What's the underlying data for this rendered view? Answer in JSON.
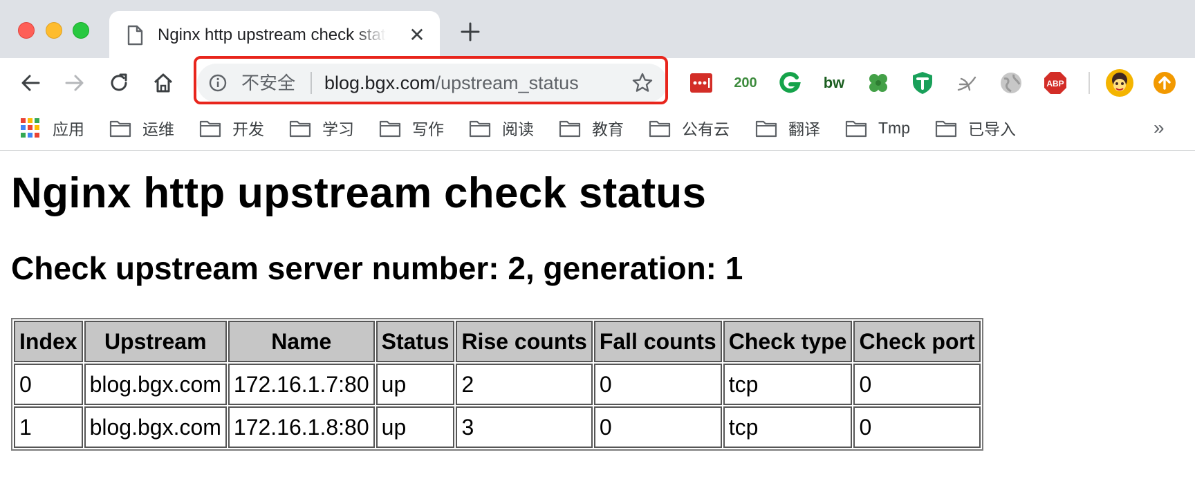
{
  "browser": {
    "tab": {
      "title": "Nginx http upstream check status"
    },
    "address_bar": {
      "security_label": "不安全",
      "url_host": "blog.bgx.com",
      "url_path": "/upstream_status"
    },
    "extensions": [
      {
        "name": "lastpass-icon",
        "text": "•••|",
        "color": "#d32d27"
      },
      {
        "name": "status-200-icon",
        "text": "200",
        "color": "#3d8b3d"
      },
      {
        "name": "grammarly-icon",
        "text": "G",
        "color": "#15c39a"
      },
      {
        "name": "bw-icon",
        "text": "bw",
        "color": "#1b5e20"
      },
      {
        "name": "clover-icon",
        "text": "",
        "color": "#43a047"
      },
      {
        "name": "shield-t-icon",
        "text": "T",
        "color": "#19a05a"
      },
      {
        "name": "calligraphy-icon",
        "text": "",
        "color": "#7a7a7a"
      },
      {
        "name": "globe-icon",
        "text": "",
        "color": "#9e9e9e"
      },
      {
        "name": "adblock-icon",
        "text": "ABP",
        "color": "#d32d27"
      }
    ]
  },
  "bookmarks": {
    "apps_label": "应用",
    "folders": [
      "运维",
      "开发",
      "学习",
      "写作",
      "阅读",
      "教育",
      "公有云",
      "翻译",
      "Tmp",
      "已导入"
    ],
    "overflow": "»"
  },
  "page": {
    "title": "Nginx http upstream check status",
    "subtitle": "Check upstream server number: 2, generation: 1",
    "table": {
      "headers": [
        "Index",
        "Upstream",
        "Name",
        "Status",
        "Rise counts",
        "Fall counts",
        "Check type",
        "Check port"
      ],
      "rows": [
        [
          "0",
          "blog.bgx.com",
          "172.16.1.7:80",
          "up",
          "2",
          "0",
          "tcp",
          "0"
        ],
        [
          "1",
          "blog.bgx.com",
          "172.16.1.8:80",
          "up",
          "3",
          "0",
          "tcp",
          "0"
        ]
      ]
    }
  }
}
